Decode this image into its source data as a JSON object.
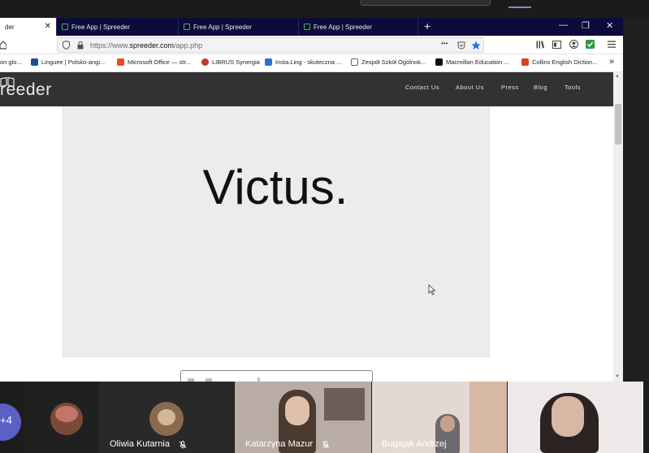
{
  "browser": {
    "tabs": [
      {
        "label": "Free App | Spreeder",
        "active": true
      },
      {
        "label": "Free App | Spreeder",
        "active": false
      },
      {
        "label": "Free App | Spreeder",
        "active": false
      },
      {
        "label": "Free App | Spreeder",
        "active": false
      }
    ],
    "active_tab_partial": "der",
    "new_tab": "+",
    "window_controls": {
      "minimize": "—",
      "restore": "❐",
      "close": "✕"
    },
    "url": {
      "prefix": "https://www.",
      "domain": "spreeder.com",
      "path": "/app.php"
    },
    "more_glyph": "•••",
    "bookmarks": [
      {
        "label": "on glo...",
        "color": "#ffffff"
      },
      {
        "label": "Linguee | Polsko-angi...",
        "color": "#1e4d8c"
      },
      {
        "label": "Microsoft Office — str...",
        "color": "#e74c1c"
      },
      {
        "label": "LIBRUS Synergia",
        "color": "#c0392b"
      },
      {
        "label": "Insta.Ling - skuteczna ...",
        "color": "#2a6fdb"
      },
      {
        "label": "Zespół Szkół Ogólnok...",
        "color": "#ffffff"
      },
      {
        "label": "Macmillan Education ...",
        "color": "#111111"
      },
      {
        "label": "Collins English Diction...",
        "color": "#d9411e"
      }
    ],
    "bookmarks_overflow": "»"
  },
  "site": {
    "logo": "reeder",
    "menu": [
      "Contact Us",
      "About Us",
      "Press",
      "Blog",
      "Tools"
    ],
    "reader_word": "Victus."
  },
  "meeting": {
    "more_count": "+4",
    "participants": [
      {
        "name": ""
      },
      {
        "name": "Oliwia Kutarnia"
      },
      {
        "name": "Katarzyna Mazur"
      },
      {
        "name": "Bugajak Andrzej"
      },
      {
        "name": ""
      }
    ]
  },
  "colors": {
    "tabstrip": "#0c0c3c",
    "site_header": "#323232",
    "reader_bg": "#ececec",
    "more_badge": "#5b5fc7"
  }
}
